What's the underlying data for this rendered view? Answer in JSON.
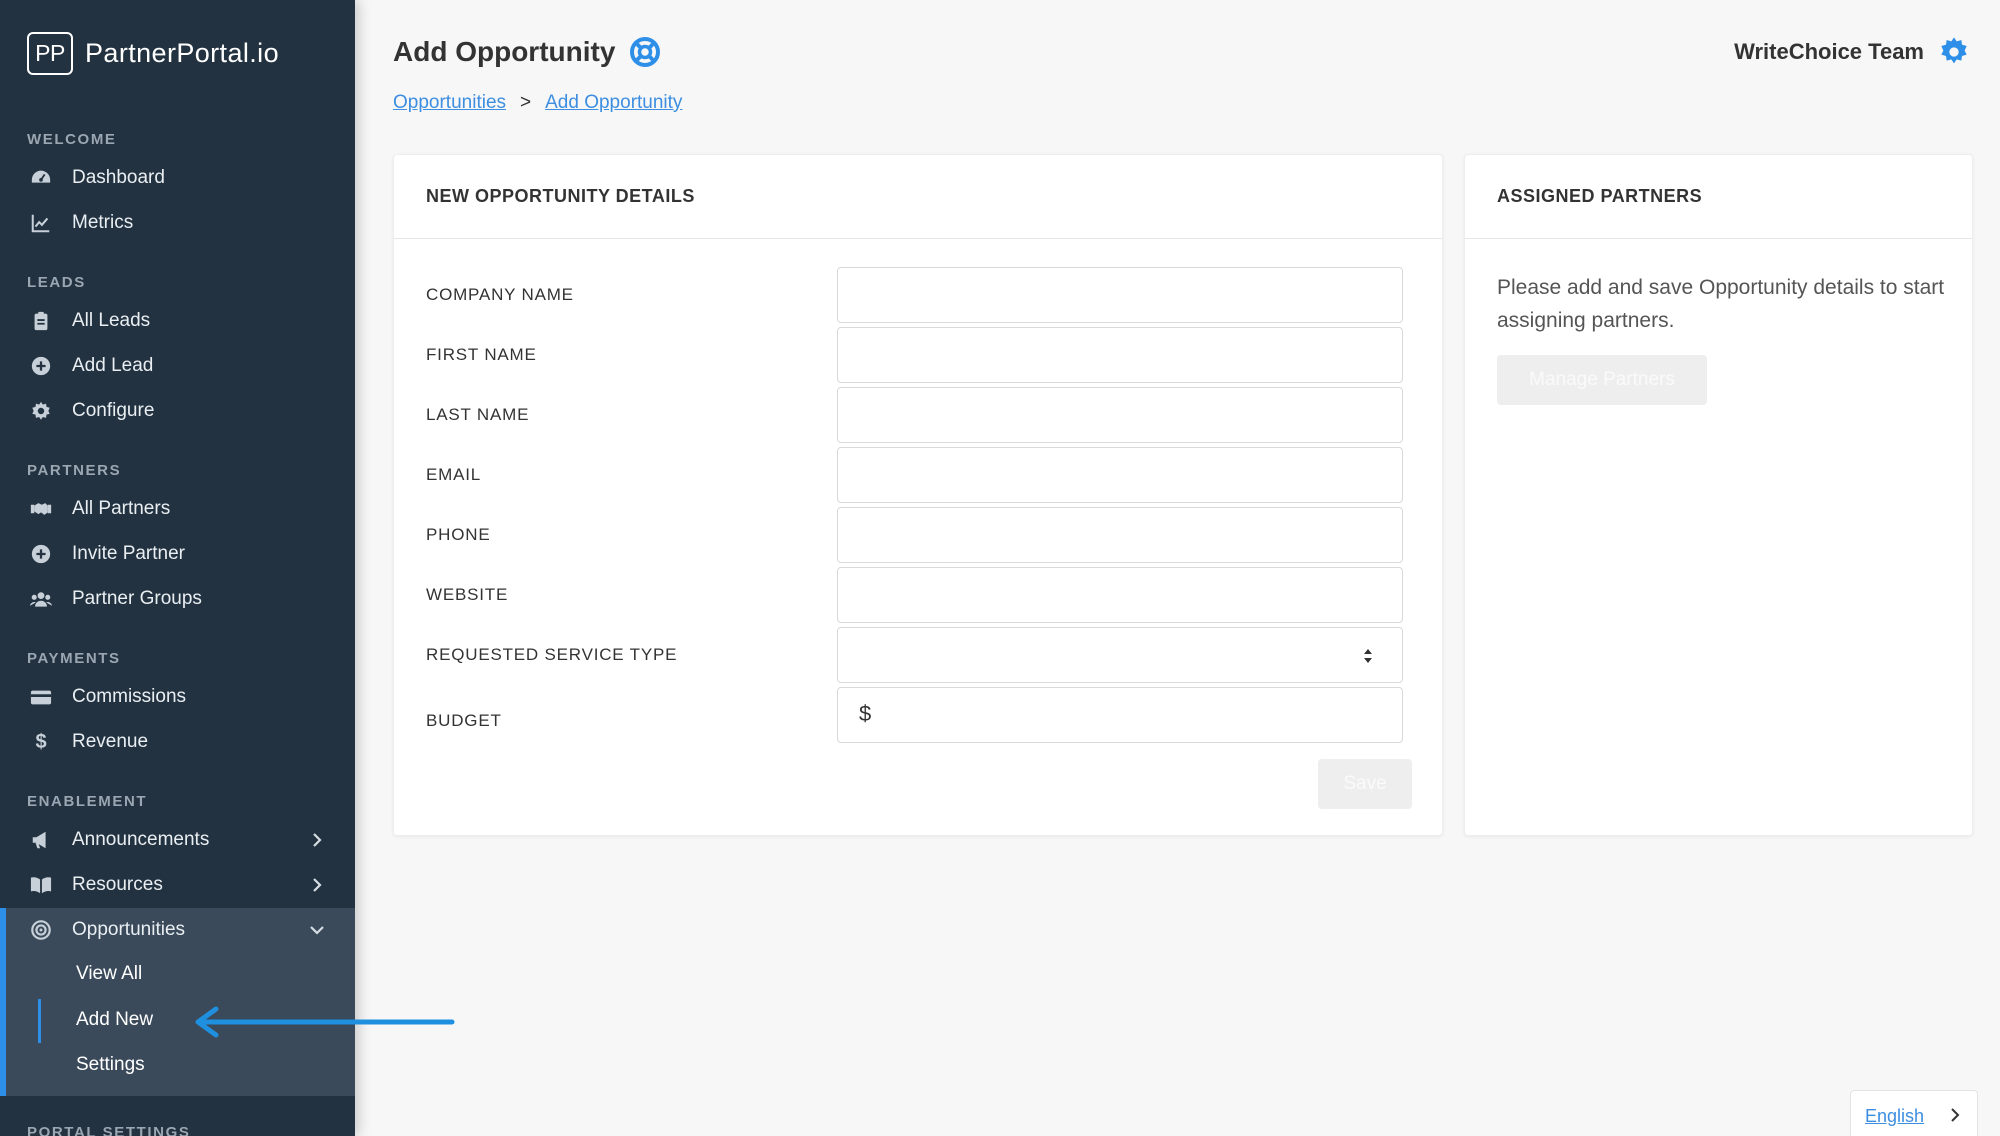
{
  "brand": {
    "logo": "PP",
    "name": "PartnerPortal.io"
  },
  "sidebar": {
    "sections": {
      "welcome": "WELCOME",
      "leads": "LEADS",
      "partners": "PARTNERS",
      "payments": "PAYMENTS",
      "enablement": "ENABLEMENT",
      "portal_settings": "PORTAL SETTINGS"
    },
    "items": {
      "dashboard": {
        "label": "Dashboard",
        "icon": "dashboard-gauge-icon"
      },
      "metrics": {
        "label": "Metrics",
        "icon": "line-chart-icon"
      },
      "all_leads": {
        "label": "All Leads",
        "icon": "clipboard-icon"
      },
      "add_lead": {
        "label": "Add Lead",
        "icon": "plus-circle-icon"
      },
      "configure": {
        "label": "Configure",
        "icon": "gear-icon"
      },
      "all_partners": {
        "label": "All Partners",
        "icon": "handshake-icon"
      },
      "invite_partner": {
        "label": "Invite Partner",
        "icon": "plus-circle-icon"
      },
      "partner_groups": {
        "label": "Partner Groups",
        "icon": "users-icon"
      },
      "commissions": {
        "label": "Commissions",
        "icon": "credit-card-icon"
      },
      "revenue": {
        "label": "Revenue",
        "icon": "dollar-icon"
      },
      "announcements": {
        "label": "Announcements",
        "icon": "megaphone-icon"
      },
      "resources": {
        "label": "Resources",
        "icon": "book-icon"
      },
      "opportunities": {
        "label": "Opportunities",
        "icon": "target-icon"
      }
    },
    "opportunities_sub": {
      "view_all": "View All",
      "add_new": "Add New",
      "settings": "Settings"
    }
  },
  "header": {
    "title": "Add Opportunity",
    "team_name": "WriteChoice Team"
  },
  "breadcrumb": {
    "parent": "Opportunities",
    "separator": ">",
    "current": "Add Opportunity"
  },
  "form": {
    "title": "NEW OPPORTUNITY DETAILS",
    "fields": {
      "company_name": "COMPANY NAME",
      "first_name": "FIRST NAME",
      "last_name": "LAST NAME",
      "email": "EMAIL",
      "phone": "PHONE",
      "website": "WEBSITE",
      "requested_service_type": "REQUESTED SERVICE TYPE",
      "budget": "BUDGET"
    },
    "currency_symbol": "$",
    "save_label": "Save"
  },
  "assigned_partners": {
    "title": "ASSIGNED PARTNERS",
    "message": "Please add and save Opportunity details to start assigning partners.",
    "manage_label": "Manage Partners"
  },
  "language": {
    "current": "English"
  },
  "colors": {
    "sidebar_bg": "#233240",
    "accent": "#2e8fe8",
    "active_group_bg": "#3a4a5a"
  }
}
